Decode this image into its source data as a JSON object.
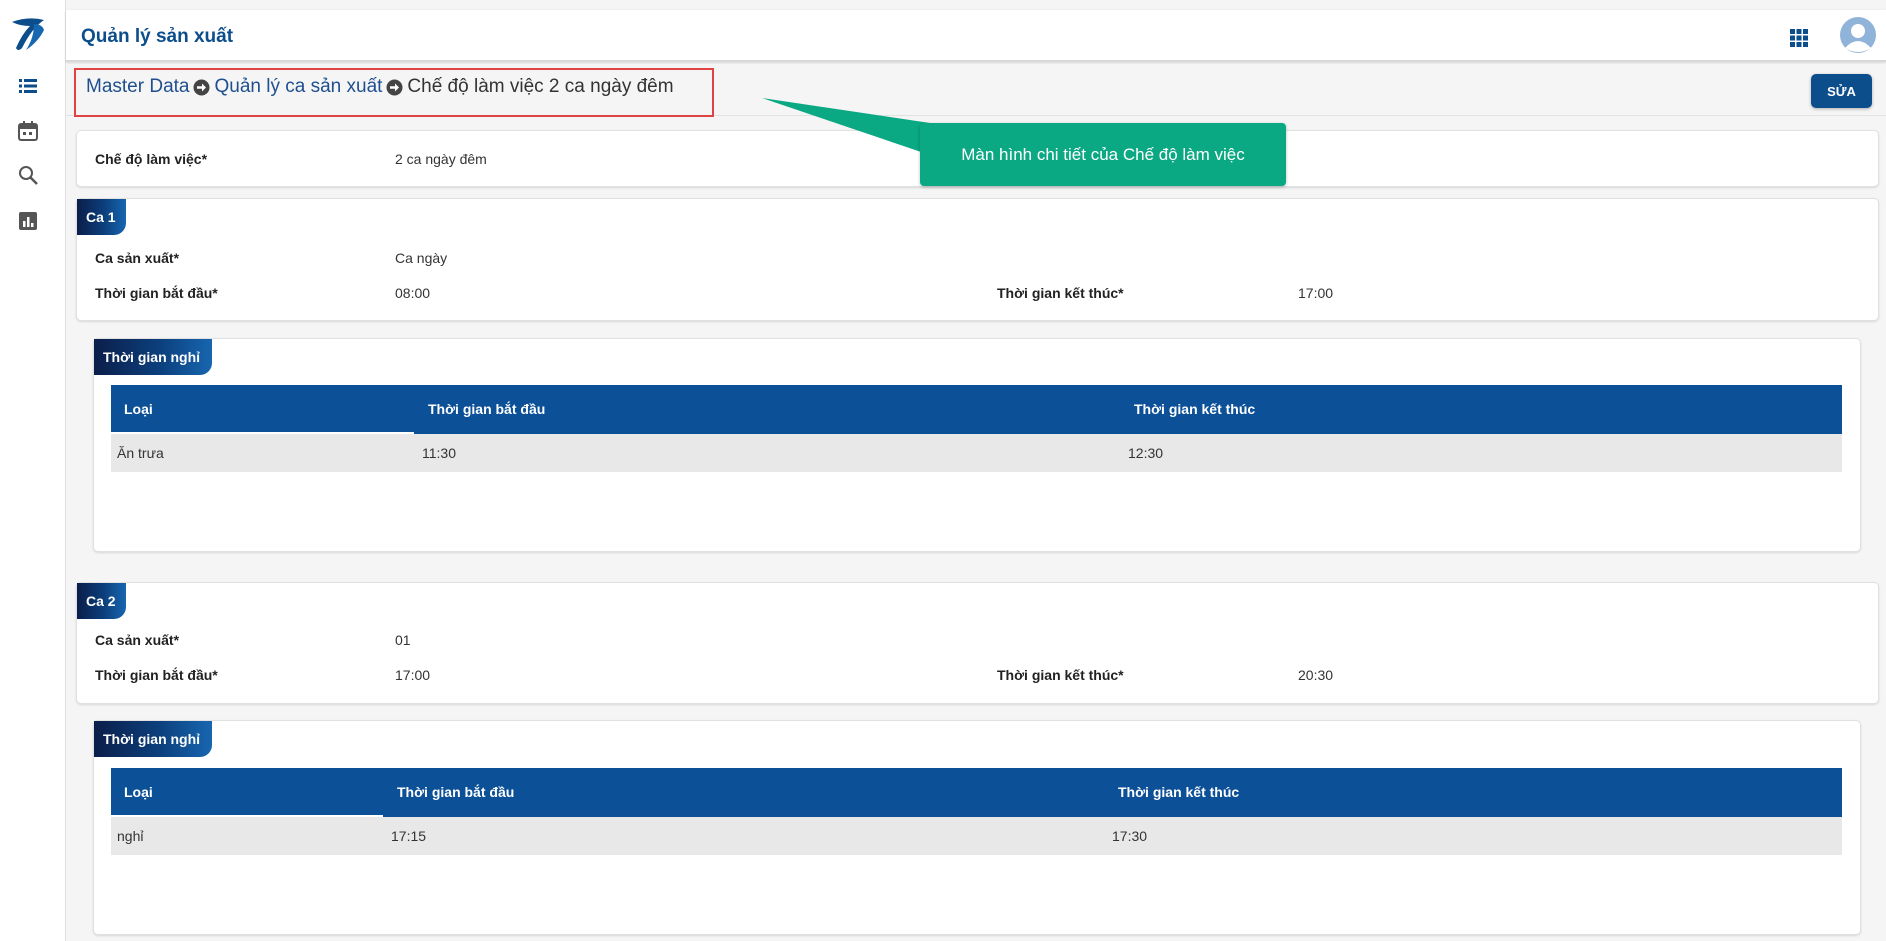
{
  "header": {
    "app_title": "Quản lý sản xuất"
  },
  "sidebar": {
    "icons": [
      "logo-icon",
      "list-icon",
      "calendar-icon",
      "search-icon",
      "chart-icon"
    ]
  },
  "breadcrumb": {
    "items": [
      "Master Data",
      "Quản lý ca sản xuất",
      "Chế độ làm việc 2 ca ngày đêm"
    ]
  },
  "toolbar": {
    "edit_label": "SỬA"
  },
  "callout": {
    "text": "Màn hình chi tiết của Chế độ làm việc"
  },
  "mode": {
    "label": "Chế độ làm việc*",
    "value": "2 ca ngày đêm"
  },
  "shifts": [
    {
      "tag": "Ca 1",
      "shift_label": "Ca sản xuất*",
      "shift_value": "Ca ngày",
      "start_label": "Thời gian bắt đầu*",
      "start_value": "08:00",
      "end_label": "Thời gian kết thúc*",
      "end_value": "17:00",
      "breaks": {
        "tag": "Thời gian nghỉ",
        "columns": [
          "Loại",
          "Thời gian bắt đầu",
          "Thời gian kết thúc"
        ],
        "rows": [
          [
            "Ăn trưa",
            "11:30",
            "12:30"
          ]
        ]
      }
    },
    {
      "tag": "Ca 2",
      "shift_label": "Ca sản xuất*",
      "shift_value": "01",
      "start_label": "Thời gian bắt đầu*",
      "start_value": "17:00",
      "end_label": "Thời gian kết thúc*",
      "end_value": "20:30",
      "breaks": {
        "tag": "Thời gian nghỉ",
        "columns": [
          "Loại",
          "Thời gian bắt đầu",
          "Thời gian kết thúc"
        ],
        "rows": [
          [
            "nghỉ",
            "17:15",
            "17:30"
          ]
        ]
      }
    }
  ],
  "colors": {
    "primary": "#0c4d8c",
    "table_header": "#0c5098",
    "callout": "#0aa883",
    "highlight_border": "#e04343"
  }
}
